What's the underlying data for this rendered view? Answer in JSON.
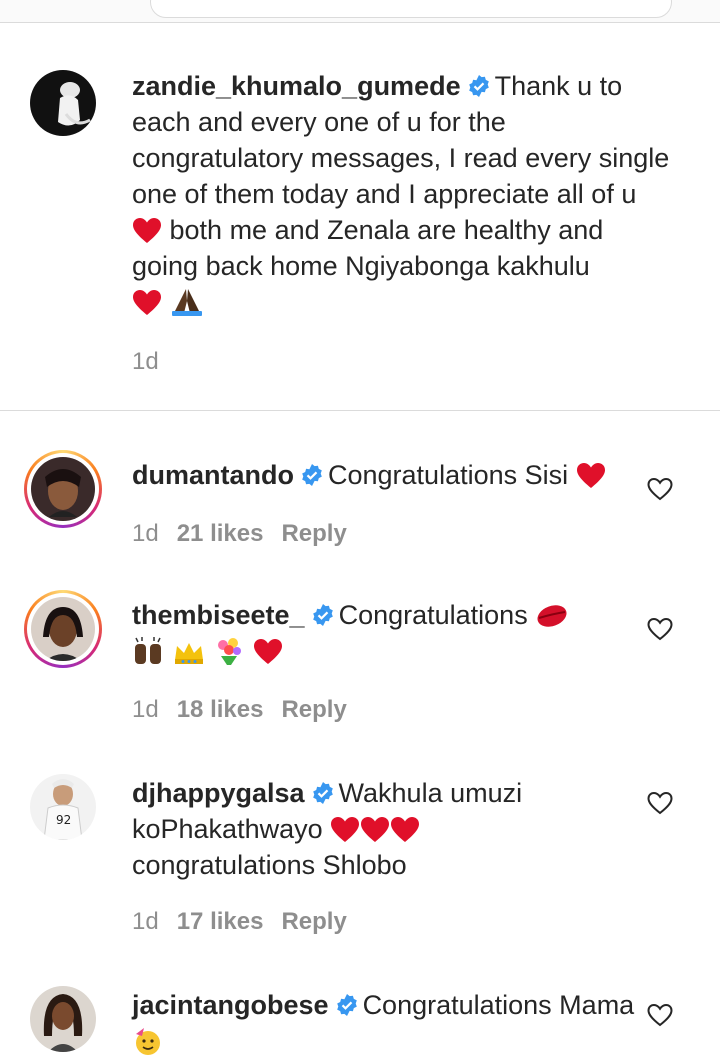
{
  "caption": {
    "username": "zandie_khumalo_gumede",
    "text": "Thank u to each and every one of u for the congratulatory messages, I read every single one of them today and I appreciate all of u",
    "text_continued": "both me and Zenala are healthy and going back home Ngiyabonga kakhulu",
    "time": "1d"
  },
  "comments": [
    {
      "username": "dumantando",
      "text": "Congratulations Sisi",
      "time": "1d",
      "likes": "21 likes",
      "reply": "Reply"
    },
    {
      "username": "thembiseete_",
      "text": "Congratulations",
      "time": "1d",
      "likes": "18 likes",
      "reply": "Reply"
    },
    {
      "username": "djhappygalsa",
      "text": "Wakhula umuzi koPhakathwayo",
      "text_continued": "congratulations Shlobo",
      "time": "1d",
      "likes": "17 likes",
      "reply": "Reply"
    },
    {
      "username": "jacintangobese",
      "text": "Congratulations Mama"
    }
  ],
  "colors": {
    "verified": "#3897f0",
    "heart": "#e0102a",
    "meta_text": "#8e8e8e",
    "divider": "#dbdbdb"
  },
  "icons": [
    "verified-badge-icon",
    "heart-outline-icon",
    "heart-emoji",
    "praying-hands-emoji",
    "kiss-emoji",
    "raised-hands-emoji",
    "crown-emoji",
    "bouquet-emoji",
    "party-face-emoji"
  ]
}
